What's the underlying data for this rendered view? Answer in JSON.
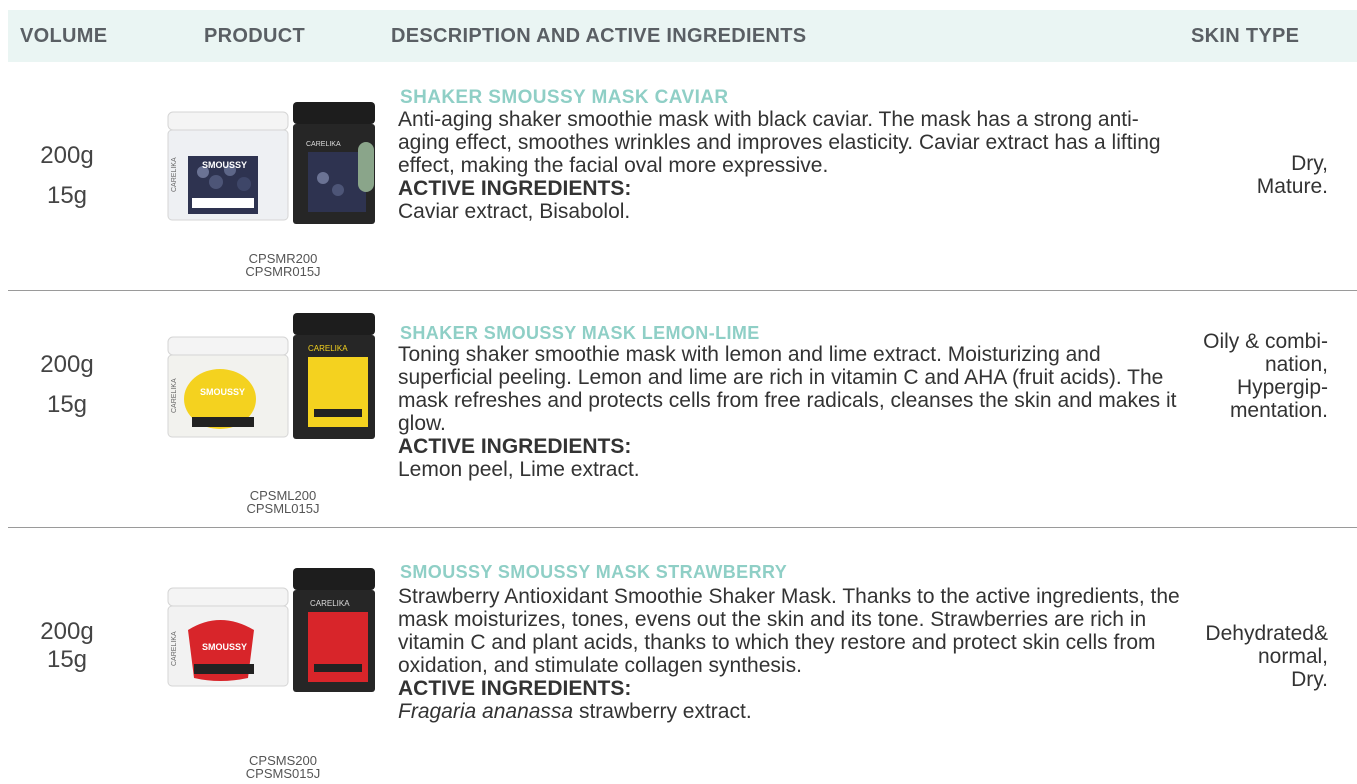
{
  "columns": {
    "volume": "VOLUME",
    "product": "PRODUCT",
    "description": "DESCRIPTION AND ACTIVE INGREDIENTS",
    "skin_type": "SKIN TYPE"
  },
  "colors": {
    "header_bg": "#eaf5f3",
    "title_accent": "#8fcfc6",
    "caviar_label": "#2e3350",
    "lemon_label": "#f4d21f",
    "strawberry_label": "#d8252a"
  },
  "products": [
    {
      "volume_1": "200g",
      "volume_2": "15g",
      "code_1": "CPSMR200",
      "code_2": "CPSMR015J",
      "title": "SHAKER SMOUSSY MASK CAVIAR",
      "description": "Anti-aging shaker smoothie mask with black caviar. The mask has a strong anti-aging effect, smoothes wrinkles and improves elasticity. Caviar extract has a lifting effect, making the facial oval more expressive.",
      "active_label": "ACTIVE INGREDIENTS:",
      "active": "Caviar extract, Bisabolol.",
      "skin_1": "Dry,",
      "skin_2": "Mature.",
      "jar_brand": "CARELIKA",
      "jar_name": "SMOUSSY"
    },
    {
      "volume_1": "200g",
      "volume_2": "15g",
      "code_1": "CPSML200",
      "code_2": "CPSML015J",
      "title": "SHAKER SMOUSSY MASK LEMON-LIME",
      "description": "Toning shaker smoothie mask with lemon and lime extract. Moisturizing and superficial peeling. Lemon and lime are rich in vitamin C and AHA (fruit acids). The mask refreshes and protects cells from free radicals, cleanses the skin and makes it glow.",
      "active_label": "ACTIVE INGREDIENTS:",
      "active": "Lemon peel, Lime extract.",
      "skin_1": "Oily & combi-",
      "skin_2": "nation,",
      "skin_3": "Hypergip-",
      "skin_4": "mentation.",
      "jar_brand": "CARELIKA",
      "jar_name": "SMOUSSY"
    },
    {
      "volume_1": "200g",
      "volume_2": "15g",
      "code_1": "CPSMS200",
      "code_2": "CPSMS015J",
      "title": "SMOUSSY SMOUSSY MASK STRAWBERRY",
      "description": "Strawberry Antioxidant Smoothie Shaker Mask. Thanks to the active ingredients, the mask moisturizes, tones, evens out the skin and its tone. Strawberries are rich in vitamin C and plant acids, thanks to which they restore and protect skin cells from oxidation, and stimulate collagen synthesis.",
      "active_label": "ACTIVE INGREDIENTS:",
      "active_italic": "Fragaria ananassa",
      "active_rest": " strawberry extract.",
      "skin_1": "Dehydrated&",
      "skin_2": "normal,",
      "skin_3": "Dry.",
      "jar_brand": "CARELIKA",
      "jar_name": "SMOUSSY"
    }
  ]
}
